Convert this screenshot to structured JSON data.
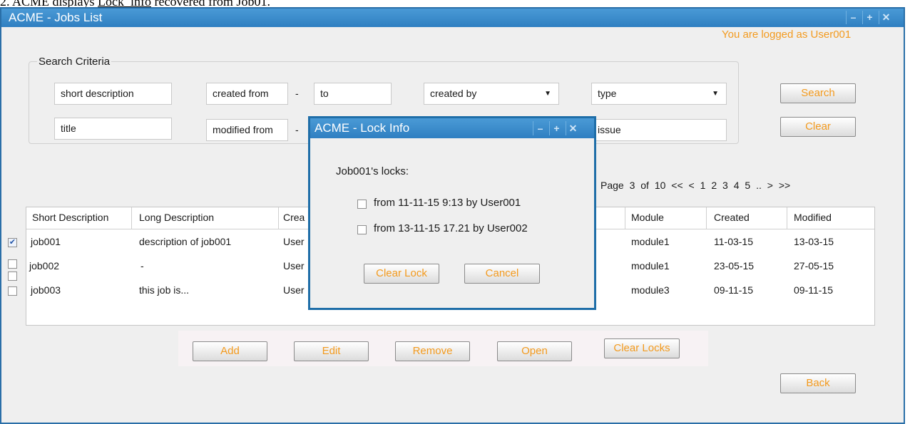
{
  "caption": {
    "prefix": "2. ACME displays ",
    "underlined": "Lock_info",
    "suffix": " recovered from Job01."
  },
  "window": {
    "title": "ACME - Jobs List",
    "minimize_icon": "minus",
    "maximize_icon": "plus",
    "close_icon": "x"
  },
  "logged_in": "You are logged as User001",
  "search": {
    "legend": "Search Criteria",
    "short_description": "short description",
    "title": "title",
    "created_from": "created from",
    "created_to": "to",
    "modified_from": "modified from",
    "dash": "-",
    "created_by": "created by",
    "type": "type",
    "issue": "issue",
    "search_label": "Search",
    "clear_label": "Clear"
  },
  "pager": {
    "label": "Page 3 of 10",
    "first": "<<",
    "prev": "<",
    "pages": [
      "1",
      "2",
      "3",
      "4",
      "5"
    ],
    "ellipsis": "..",
    "next": ">",
    "last": ">>"
  },
  "table": {
    "columns": [
      "Short Description",
      "Long Description",
      "Created by",
      "Module",
      "Created",
      "Modified"
    ],
    "col_fragment": "Crea",
    "rows": [
      {
        "checked": true,
        "short": "job001",
        "long": "description of job001",
        "created_by": "User",
        "module": "module1",
        "created": "11-03-15",
        "modified": "13-03-15"
      },
      {
        "checked": false,
        "short": "job002",
        "long": "-",
        "created_by": "User",
        "module": "module1",
        "created": "23-05-15",
        "modified": "27-05-15"
      },
      {
        "checked": false,
        "short": "job003",
        "long": "this job is...",
        "created_by": "User",
        "module": "module3",
        "created": "09-11-15",
        "modified": "09-11-15"
      }
    ]
  },
  "actions": {
    "add": "Add",
    "edit": "Edit",
    "remove": "Remove",
    "open": "Open",
    "clear_locks": "Clear Locks",
    "back": "Back"
  },
  "dialog": {
    "title": "ACME - Lock Info",
    "heading": "Job001's locks:",
    "locks": [
      {
        "checked": false,
        "label": "from 11-11-15 9:13 by User001"
      },
      {
        "checked": false,
        "label": "from 13-11-15 17.21 by User002"
      }
    ],
    "clear_lock": "Clear Lock",
    "cancel": "Cancel"
  },
  "colors": {
    "title_bar": "#2f7fc1",
    "accent_orange": "#f39a1e",
    "window_bg": "#efefef"
  }
}
